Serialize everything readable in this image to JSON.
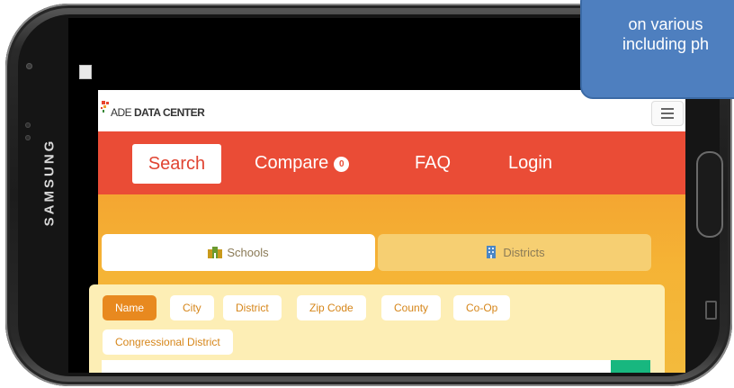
{
  "device": {
    "brand": "SAMSUNG"
  },
  "site": {
    "logo_text_light": "ADE ",
    "logo_text_bold": "DATA CENTER"
  },
  "nav": {
    "search": "Search",
    "compare": "Compare",
    "compare_count": "0",
    "faq": "FAQ",
    "login": "Login"
  },
  "tabs": {
    "schools": "Schools",
    "districts": "Districts"
  },
  "filters": [
    "Name",
    "City",
    "District",
    "Zip Code",
    "County",
    "Co-Op",
    "Congressional District"
  ],
  "filters_active": "Name",
  "callout": {
    "line1": "on various",
    "line2": "including ph"
  },
  "colors": {
    "navbar": "#ea4c36",
    "content_orange": "#f4a631",
    "chip_active": "#e8891f",
    "search_button": "#18b77f",
    "callout": "#4e7fbf"
  }
}
